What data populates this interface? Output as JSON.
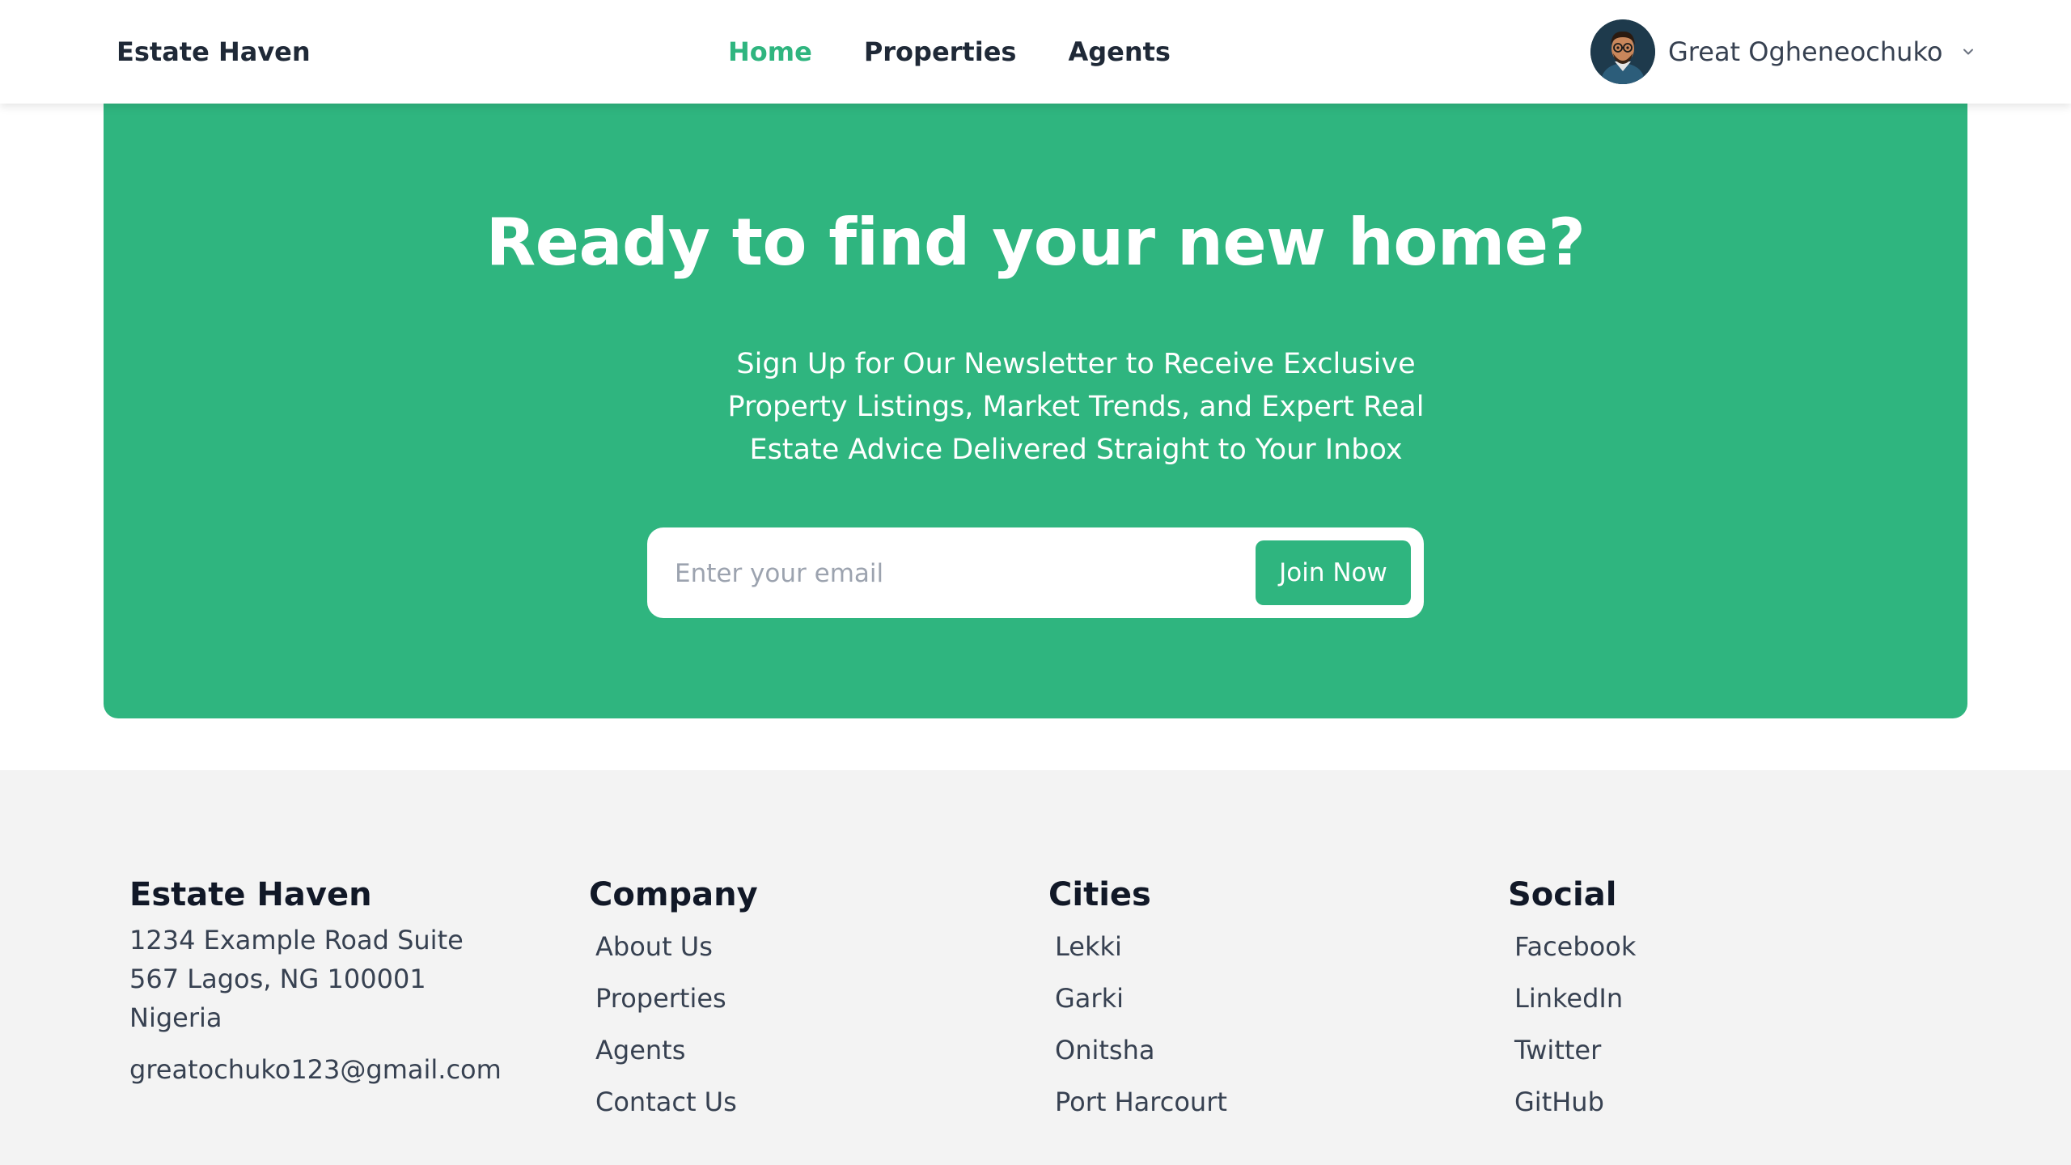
{
  "header": {
    "brand": "Estate Haven",
    "nav": [
      {
        "label": "Home",
        "active": true
      },
      {
        "label": "Properties",
        "active": false
      },
      {
        "label": "Agents",
        "active": false
      }
    ],
    "user": {
      "name": "Great Ogheneochuko",
      "avatar_icon": "user-avatar",
      "dropdown_icon": "chevron-down-icon"
    }
  },
  "hero": {
    "title": "Ready to find your new home?",
    "subtitle": "Sign Up for Our Newsletter to Receive Exclusive Property Listings, Market Trends, and Expert Real Estate Advice Delivered Straight to Your Inbox",
    "email_placeholder": "Enter your email",
    "email_value": "",
    "button_label": "Join Now"
  },
  "footer": {
    "brand": {
      "title": "Estate Haven",
      "address": "1234 Example Road Suite 567 Lagos, NG 100001 Nigeria",
      "email": "greatochuko123@gmail.com"
    },
    "company": {
      "title": "Company",
      "links": [
        "About Us",
        "Properties",
        "Agents",
        "Contact Us"
      ]
    },
    "cities": {
      "title": "Cities",
      "links": [
        "Lekki",
        "Garki",
        "Onitsha",
        "Port Harcourt"
      ]
    },
    "social": {
      "title": "Social",
      "links": [
        "Facebook",
        "LinkedIn",
        "Twitter",
        "GitHub"
      ]
    }
  },
  "colors": {
    "accent": "#2fb57f",
    "text_dark": "#1f2937",
    "footer_bg": "#f3f3f3",
    "white": "#ffffff"
  }
}
